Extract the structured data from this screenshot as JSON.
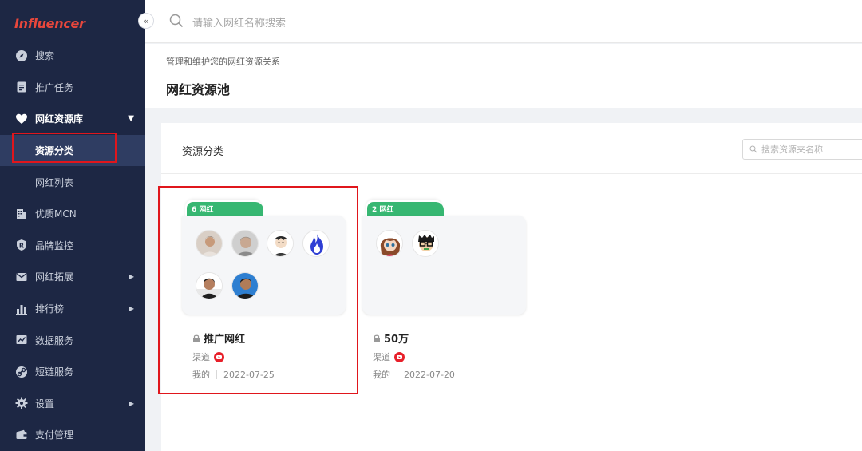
{
  "app": {
    "logo_text": "Influencer",
    "collapse_glyph": "«"
  },
  "sidebar": {
    "items": [
      {
        "label": "搜索",
        "icon": "compass-icon"
      },
      {
        "label": "推广任务",
        "icon": "document-icon"
      },
      {
        "label": "网红资源库",
        "icon": "heart-icon",
        "expanded": true
      },
      {
        "label": "优质MCN",
        "icon": "building-icon"
      },
      {
        "label": "品牌监控",
        "icon": "registered-icon"
      },
      {
        "label": "网红拓展",
        "icon": "mail-icon",
        "has_submenu": true
      },
      {
        "label": "排行榜",
        "icon": "bar-chart-icon",
        "has_submenu": true
      },
      {
        "label": "数据服务",
        "icon": "line-chart-icon"
      },
      {
        "label": "短链服务",
        "icon": "link-icon"
      },
      {
        "label": "设置",
        "icon": "gear-icon",
        "has_submenu": true
      },
      {
        "label": "支付管理",
        "icon": "wallet-icon"
      }
    ],
    "subitems": [
      {
        "label": "资源分类",
        "active": true
      },
      {
        "label": "网红列表",
        "active": false
      }
    ]
  },
  "topbar": {
    "search_placeholder": "请输入网红名称搜索"
  },
  "header": {
    "breadcrumb": "管理和维护您的网红资源关系",
    "title": "网红资源池"
  },
  "panel": {
    "title": "资源分类",
    "search_placeholder": "搜索资源夹名称"
  },
  "cards": [
    {
      "badge": "6 网红",
      "name": "推广网红",
      "channel_label": "渠道",
      "owner": "我的",
      "date": "2022-07-25",
      "avatar_count": 6
    },
    {
      "badge": "2 网红",
      "name": "50万",
      "channel_label": "渠道",
      "owner": "我的",
      "date": "2022-07-20",
      "avatar_count": 2
    }
  ],
  "colors": {
    "sidebar_bg": "#1d2744",
    "accent_green": "#37b772",
    "highlight_red": "#e0161c",
    "youtube_red": "#e8202a"
  }
}
